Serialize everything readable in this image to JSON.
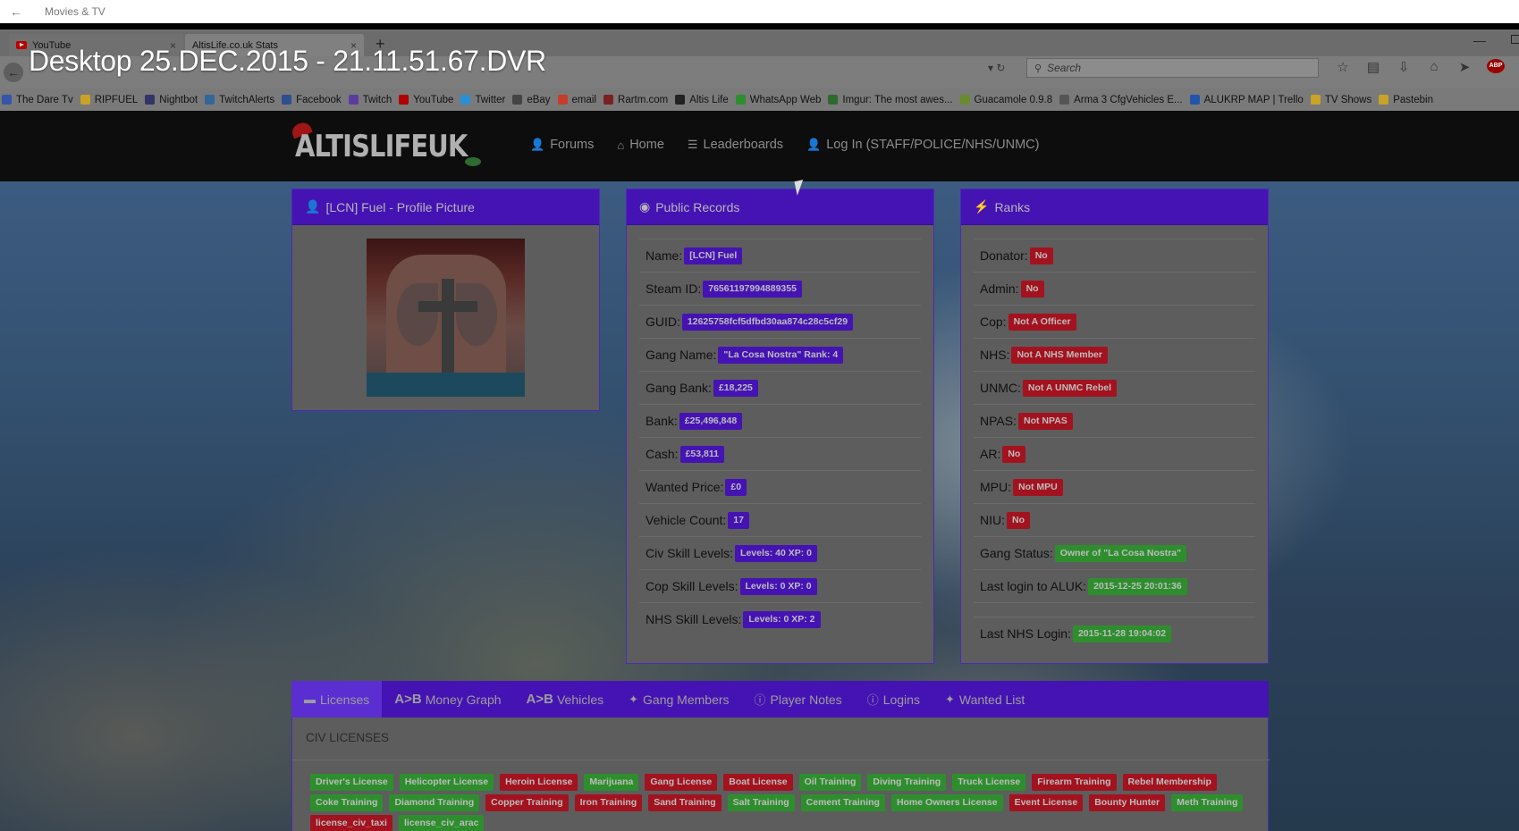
{
  "app": {
    "title": "Movies & TV",
    "back_icon": "back-arrow-icon"
  },
  "overlay_title": "Desktop 25.DEC.2015 - 21.11.51.67.DVR",
  "browser": {
    "tabs": [
      {
        "label": "YouTube",
        "icon": "youtube-icon"
      },
      {
        "label": "AltisLife.co.uk Stats",
        "icon": ""
      }
    ],
    "search_placeholder": "Search",
    "bookmarks": [
      {
        "label": "The Dare Tv",
        "color": "#3355aa"
      },
      {
        "label": "RIPFUEL",
        "color": "#c9a227"
      },
      {
        "label": "Nightbot",
        "color": "#333366"
      },
      {
        "label": "TwitchAlerts",
        "color": "#336699"
      },
      {
        "label": "Facebook",
        "color": "#2d4f8e"
      },
      {
        "label": "Twitch",
        "color": "#5b3c9e"
      },
      {
        "label": "YouTube",
        "color": "#b00000"
      },
      {
        "label": "Twitter",
        "color": "#2a8fd6"
      },
      {
        "label": "eBay",
        "color": "#444444"
      },
      {
        "label": "email",
        "color": "#c73b2b"
      },
      {
        "label": "Rartm.com",
        "color": "#7a2020"
      },
      {
        "label": "Altis Life",
        "color": "#222222"
      },
      {
        "label": "WhatsApp Web",
        "color": "#2e8e2e"
      },
      {
        "label": "Imgur: The most awes...",
        "color": "#2e6a2e"
      },
      {
        "label": "Guacamole 0.9.8",
        "color": "#6a8a2e"
      },
      {
        "label": "Arma 3 CfgVehicles E...",
        "color": "#555555"
      },
      {
        "label": "ALUKRP MAP | Trello",
        "color": "#2255aa"
      },
      {
        "label": "TV Shows",
        "color": "#c9a227"
      },
      {
        "label": "Pastebin",
        "color": "#c9a227"
      }
    ]
  },
  "site": {
    "logo_text": "ALTISLIFEUK",
    "menu": [
      {
        "label": "Forums",
        "icon": "user-icon"
      },
      {
        "label": "Home",
        "icon": "home-icon"
      },
      {
        "label": "Leaderboards",
        "icon": "list-icon"
      },
      {
        "label": "Log In (STAFF/POLICE/NHS/UNMC)",
        "icon": "user-red-icon"
      }
    ],
    "profile_panel_title": "[LCN] Fuel - Profile Picture",
    "records_panel_title": "Public Records",
    "ranks_panel_title": "Ranks",
    "records": [
      {
        "label": "Name:",
        "value": "[LCN] Fuel"
      },
      {
        "label": "Steam ID:",
        "value": "76561197994889355"
      },
      {
        "label": "GUID:",
        "value": "12625758fcf5dfbd30aa874c28c5cf29"
      },
      {
        "label": "Gang Name:",
        "value": "\"La Cosa Nostra\" Rank: 4"
      },
      {
        "label": "Gang Bank:",
        "value": "£18,225"
      },
      {
        "label": "Bank:",
        "value": "£25,496,848"
      },
      {
        "label": "Cash:",
        "value": "£53,811"
      },
      {
        "label": "Wanted Price:",
        "value": "£0"
      },
      {
        "label": "Vehicle Count:",
        "value": "17"
      },
      {
        "label": "Civ Skill Levels:",
        "value": "Levels: 40 XP: 0"
      },
      {
        "label": "Cop Skill Levels:",
        "value": "Levels: 0 XP: 0"
      },
      {
        "label": "NHS Skill Levels:",
        "value": "Levels: 0 XP: 2"
      }
    ],
    "ranks": [
      {
        "label": "Donator:",
        "value": "No",
        "color": "red"
      },
      {
        "label": "Admin:",
        "value": "No",
        "color": "red"
      },
      {
        "label": "Cop:",
        "value": "Not A Officer",
        "color": "red"
      },
      {
        "label": "NHS:",
        "value": "Not A NHS Member",
        "color": "red"
      },
      {
        "label": "UNMC:",
        "value": "Not A UNMC Rebel",
        "color": "red"
      },
      {
        "label": "NPAS:",
        "value": "Not NPAS",
        "color": "red"
      },
      {
        "label": "AR:",
        "value": "No",
        "color": "red"
      },
      {
        "label": "MPU:",
        "value": "Not MPU",
        "color": "red"
      },
      {
        "label": "NIU:",
        "value": "No",
        "color": "red"
      },
      {
        "label": "Gang Status:",
        "value": "Owner of \"La Cosa Nostra\"",
        "color": "green"
      },
      {
        "label": "Last login to ALUK:",
        "value": "2015-12-25 20:01:36",
        "color": "green"
      },
      {
        "label": "",
        "value": "",
        "color": ""
      },
      {
        "label": "Last NHS Login:",
        "value": "2015-11-28 19:04:02",
        "color": "green"
      }
    ],
    "bottom_tabs": [
      {
        "label": "Licenses",
        "icon": "card-icon"
      },
      {
        "label": "Money Graph",
        "icon": "ab-icon",
        "prefix": "A>B"
      },
      {
        "label": "Vehicles",
        "icon": "ab-icon",
        "prefix": "A>B"
      },
      {
        "label": "Gang Members",
        "icon": "move-icon"
      },
      {
        "label": "Player Notes",
        "icon": "info-icon"
      },
      {
        "label": "Logins",
        "icon": "info-icon"
      },
      {
        "label": "Wanted List",
        "icon": "move-icon"
      }
    ],
    "civ_licenses_title": "CIV LICENSES",
    "licenses": [
      {
        "label": "Driver's License",
        "color": "green"
      },
      {
        "label": "Helicopter License",
        "color": "green"
      },
      {
        "label": "Heroin License",
        "color": "red"
      },
      {
        "label": "Marijuana",
        "color": "green"
      },
      {
        "label": "Gang License",
        "color": "red"
      },
      {
        "label": "Boat License",
        "color": "red"
      },
      {
        "label": "Oil Training",
        "color": "green"
      },
      {
        "label": "Diving Training",
        "color": "green"
      },
      {
        "label": "Truck License",
        "color": "green"
      },
      {
        "label": "Firearm Training",
        "color": "red"
      },
      {
        "label": "Rebel Membership",
        "color": "red"
      },
      {
        "label": "Coke Training",
        "color": "green"
      },
      {
        "label": "Diamond Training",
        "color": "green"
      },
      {
        "label": "Copper Training",
        "color": "red"
      },
      {
        "label": "Iron Training",
        "color": "red"
      },
      {
        "label": "Sand Training",
        "color": "red"
      },
      {
        "label": "Salt Training",
        "color": "green"
      },
      {
        "label": "Cement Training",
        "color": "green"
      },
      {
        "label": "Home Owners License",
        "color": "green"
      },
      {
        "label": "Event License",
        "color": "red"
      },
      {
        "label": "Bounty Hunter",
        "color": "red"
      },
      {
        "label": "Meth Training",
        "color": "green"
      },
      {
        "label": "license_civ_taxi",
        "color": "red"
      },
      {
        "label": "license_civ_arac",
        "color": "green"
      }
    ]
  },
  "colors": {
    "accent": "#4513b3",
    "red": "#a3121f",
    "green": "#2e8e2e"
  }
}
